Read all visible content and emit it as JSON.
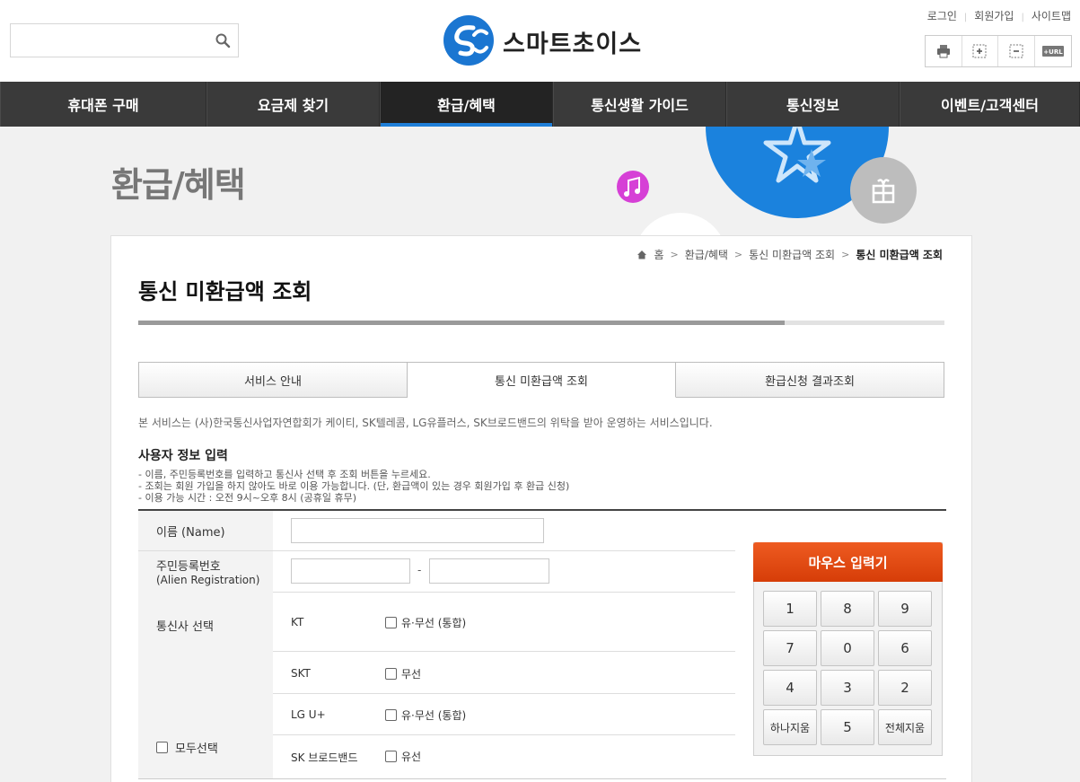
{
  "header": {
    "search_placeholder": "",
    "logo_text": "스마트초이스",
    "util_links": [
      "로그인",
      "회원가입",
      "사이트맵"
    ],
    "tools": [
      "print-icon",
      "zoom-in-icon",
      "zoom-out-icon",
      "url-copy-icon"
    ],
    "tool_url_label": "+URL"
  },
  "nav": {
    "items": [
      "휴대폰 구매",
      "요금제 찾기",
      "환급/혜택",
      "통신생활 가이드",
      "통신정보",
      "이벤트/고객센터"
    ],
    "active_index": 2
  },
  "hero": {
    "title": "환급/혜택"
  },
  "breadcrumb": {
    "home": "홈",
    "level1": "환급/혜택",
    "level2": "통신 미환급액 조회",
    "current": "통신 미환급액 조회"
  },
  "page": {
    "title": "통신 미환급액 조회",
    "tabs": [
      "서비스 안내",
      "통신 미환급액 조회",
      "환급신청 결과조회"
    ],
    "active_tab": 1,
    "notice": "본 서비스는 (사)한국통신사업자연합회가 케이티, SK텔레콤, LG유플러스, SK브로드밴드의 위탁을 받아 운영하는 서비스입니다.",
    "section_title": "사용자 정보 입력",
    "guide": [
      "- 이름, 주민등록번호를 입력하고 통신사 선택 후 조회 버튼을 누르세요.",
      "- 조회는 회원 가입을 하지 않아도 바로 이용 가능합니다. (단, 환급액이 있는 경우 회원가입 후 환급 신청)",
      "- 이용 가능 시간 : 오전 9시~오후 8시 (공휴일 휴무)"
    ]
  },
  "form": {
    "name_label": "이름 (Name)",
    "name_value": "",
    "rrn_label": "주민등록번호",
    "rrn_sub_label": "(Alien Registration)",
    "rrn_front": "",
    "rrn_back": "",
    "rrn_dash": "-",
    "carrier_label": "통신사 선택",
    "select_all_label": "모두선택",
    "carriers": [
      {
        "name": "KT",
        "option": "유·무선 (통합)"
      },
      {
        "name": "SKT",
        "option": "무선"
      },
      {
        "name": "LG U+",
        "option": "유·무선 (통합)"
      },
      {
        "name": "SK 브로드밴드",
        "option": "유선"
      }
    ]
  },
  "keypad": {
    "title": "마우스 입력기",
    "keys": [
      "1",
      "8",
      "9",
      "7",
      "0",
      "6",
      "4",
      "3",
      "2",
      "하나지움",
      "5",
      "전체지움"
    ]
  }
}
